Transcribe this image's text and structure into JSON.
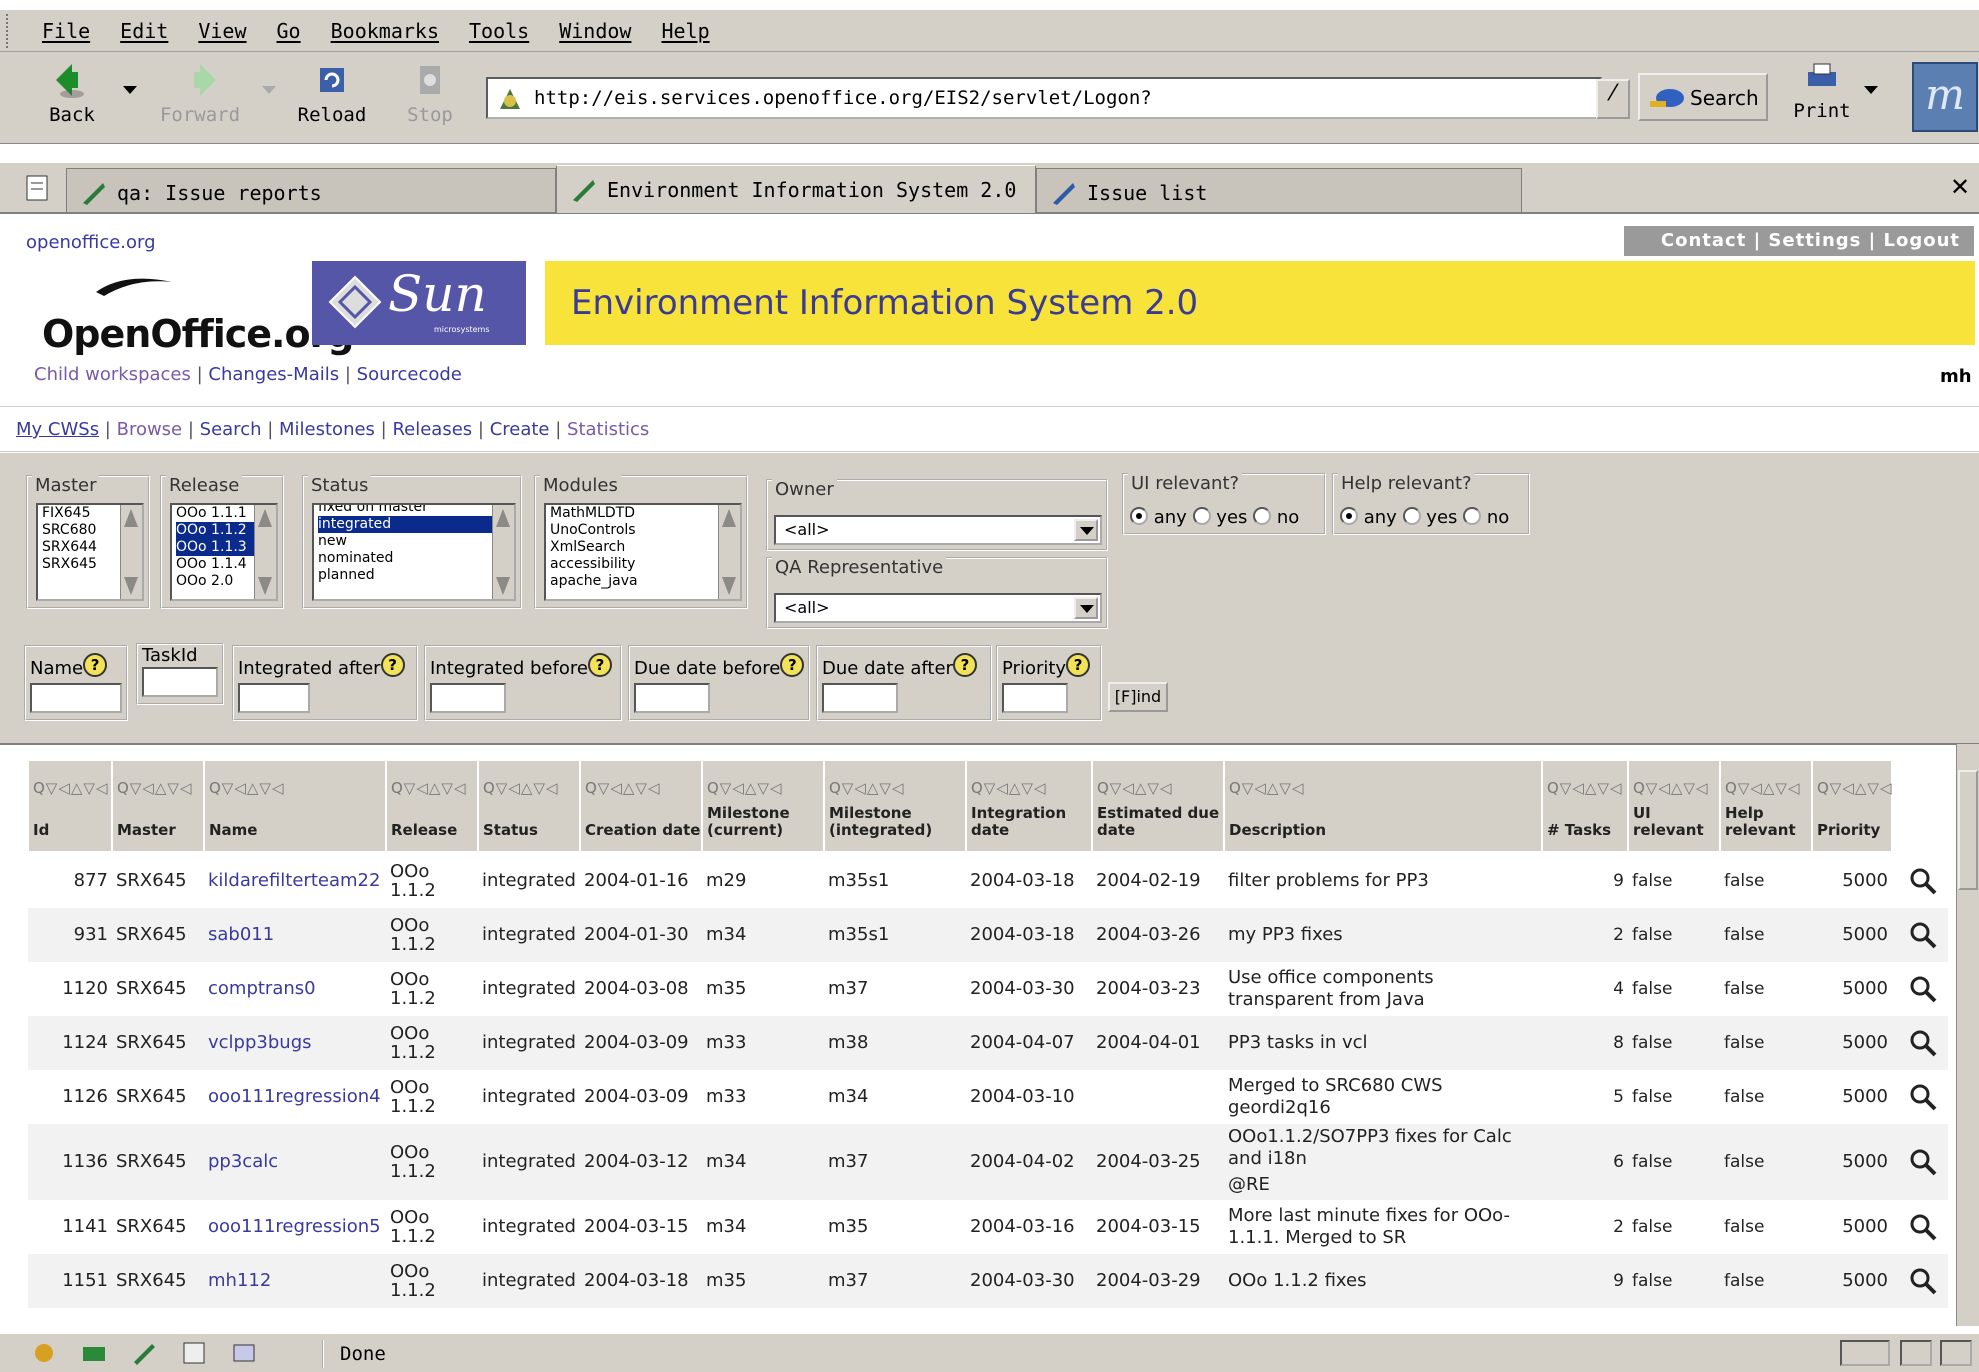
{
  "menu": [
    "File",
    "Edit",
    "View",
    "Go",
    "Bookmarks",
    "Tools",
    "Window",
    "Help"
  ],
  "nav": {
    "back": "Back",
    "forward": "Forward",
    "reload": "Reload",
    "stop": "Stop",
    "print": "Print",
    "search": "Search"
  },
  "url": "http://eis.services.openoffice.org/EIS2/servlet/Logon?",
  "tabs": [
    "qa: Issue reports",
    "Environment Information System 2.0",
    "Issue list"
  ],
  "site": {
    "url_text": "openoffice.org",
    "top_links": "Contact | Settings | Logout",
    "sun_text": "Sun",
    "sun_sub": "microsystems",
    "oo_logo": "OpenOffice.org",
    "title": "Environment Information System 2.0",
    "sub_links": [
      "Child workspaces",
      "Changes-Mails",
      "Sourcecode"
    ],
    "user": "mh",
    "cws_nav": [
      "My CWSs",
      "Browse",
      "Search",
      "Milestones",
      "Releases",
      "Create",
      "Statistics"
    ]
  },
  "filters": {
    "master": {
      "label": "Master",
      "items": [
        "FIX645",
        "SRC680",
        "SRX644",
        "SRX645"
      ]
    },
    "release": {
      "label": "Release",
      "items": [
        "OOo 1.1.1",
        "OOo 1.1.2",
        "OOo 1.1.3",
        "OOo 1.1.4",
        "OOo 2.0"
      ]
    },
    "status": {
      "label": "Status",
      "items": [
        "fixed on master",
        "integrated",
        "new",
        "nominated",
        "planned"
      ]
    },
    "modules": {
      "label": "Modules",
      "items": [
        "MathMLDTD",
        "UnoControls",
        "XmlSearch",
        "accessibility",
        "apache_java"
      ]
    },
    "owner": {
      "label": "Owner",
      "value": "<all>"
    },
    "qa": {
      "label": "QA Representative",
      "value": "<all>"
    },
    "ui_relevant": {
      "label": "UI relevant?",
      "opts": [
        "any",
        "yes",
        "no"
      ]
    },
    "help_relevant": {
      "label": "Help relevant?",
      "opts": [
        "any",
        "yes",
        "no"
      ]
    },
    "name": "Name",
    "taskid": "TaskId",
    "int_after": "Integrated after",
    "int_before": "Integrated before",
    "due_before": "Due date before",
    "due_after": "Due date after",
    "priority": "Priority",
    "help_glyph": "?",
    "find": "[F]ind"
  },
  "table": {
    "sort_glyph": "Q▽◁△▽◁",
    "columns": [
      "Id",
      "Master",
      "Name",
      "Release",
      "Status",
      "Creation date",
      "Milestone (current)",
      "Milestone (integrated)",
      "Integration date",
      "Estimated due date",
      "Description",
      "# Tasks",
      "UI relevant",
      "Help relevant",
      "Priority"
    ],
    "rows": [
      {
        "id": "877",
        "master": "SRX645",
        "name": "kildarefilterteam22",
        "release": "OOo 1.1.2",
        "status": "integrated",
        "created": "2004-01-16",
        "mcur": "m29",
        "mint": "m35s1",
        "idate": "2004-03-18",
        "due": "2004-02-19",
        "desc": "filter problems for PP3",
        "tasks": "9",
        "ui": "false",
        "help": "false",
        "prio": "5000"
      },
      {
        "id": "931",
        "master": "SRX645",
        "name": "sab011",
        "release": "OOo 1.1.2",
        "status": "integrated",
        "created": "2004-01-30",
        "mcur": "m34",
        "mint": "m35s1",
        "idate": "2004-03-18",
        "due": "2004-03-26",
        "desc": "my PP3 fixes",
        "tasks": "2",
        "ui": "false",
        "help": "false",
        "prio": "5000"
      },
      {
        "id": "1120",
        "master": "SRX645",
        "name": "comptrans0",
        "release": "OOo 1.1.2",
        "status": "integrated",
        "created": "2004-03-08",
        "mcur": "m35",
        "mint": "m37",
        "idate": "2004-03-30",
        "due": "2004-03-23",
        "desc": "Use office components transparent from Java",
        "tasks": "4",
        "ui": "false",
        "help": "false",
        "prio": "5000"
      },
      {
        "id": "1124",
        "master": "SRX645",
        "name": "vclpp3bugs",
        "release": "OOo 1.1.2",
        "status": "integrated",
        "created": "2004-03-09",
        "mcur": "m33",
        "mint": "m38",
        "idate": "2004-04-07",
        "due": "2004-04-01",
        "desc": "PP3 tasks in vcl",
        "tasks": "8",
        "ui": "false",
        "help": "false",
        "prio": "5000"
      },
      {
        "id": "1126",
        "master": "SRX645",
        "name": "ooo111regression4",
        "release": "OOo 1.1.2",
        "status": "integrated",
        "created": "2004-03-09",
        "mcur": "m33",
        "mint": "m34",
        "idate": "2004-03-10",
        "due": "",
        "desc": "Merged to SRC680 CWS geordi2q16",
        "tasks": "5",
        "ui": "false",
        "help": "false",
        "prio": "5000"
      },
      {
        "id": "1136",
        "master": "SRX645",
        "name": "pp3calc",
        "release": "OOo 1.1.2",
        "status": "integrated",
        "created": "2004-03-12",
        "mcur": "m34",
        "mint": "m37",
        "idate": "2004-04-02",
        "due": "2004-03-25",
        "desc": "OOo1.1.2/SO7PP3 fixes for Calc and i18n",
        "desc2": "@RE",
        "tasks": "6",
        "ui": "false",
        "help": "false",
        "prio": "5000"
      },
      {
        "id": "1141",
        "master": "SRX645",
        "name": "ooo111regression5",
        "release": "OOo 1.1.2",
        "status": "integrated",
        "created": "2004-03-15",
        "mcur": "m34",
        "mint": "m35",
        "idate": "2004-03-16",
        "due": "2004-03-15",
        "desc": "More last minute fixes for OOo-1.1.1. Merged to SR",
        "tasks": "2",
        "ui": "false",
        "help": "false",
        "prio": "5000"
      },
      {
        "id": "1151",
        "master": "SRX645",
        "name": "mh112",
        "release": "OOo 1.1.2",
        "status": "integrated",
        "created": "2004-03-18",
        "mcur": "m35",
        "mint": "m37",
        "idate": "2004-03-30",
        "due": "2004-03-29",
        "desc": "OOo 1.1.2 fixes",
        "tasks": "9",
        "ui": "false",
        "help": "false",
        "prio": "5000"
      }
    ]
  },
  "status_text": "Done"
}
